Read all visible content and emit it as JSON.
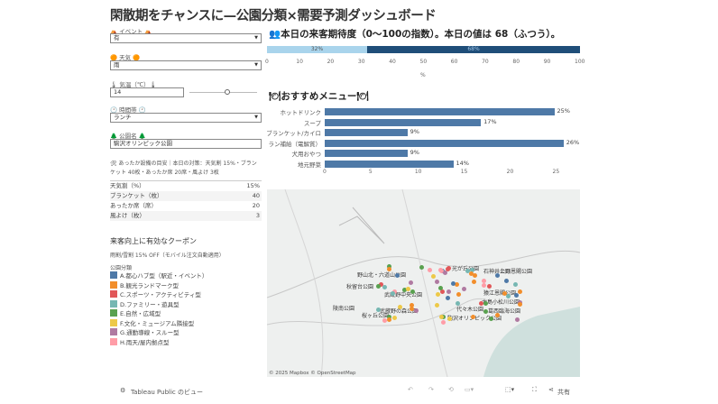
{
  "title": "閑散期をチャンスに—公園分類×需要予測ダッシュボード",
  "filters": {
    "event": {
      "label": "⛺ イベント ⛺",
      "value": "有"
    },
    "weather": {
      "label": "🟠 天気 🟠",
      "value": "雨"
    },
    "temp": {
      "label": "🌡 気温（℃）🌡",
      "value": "14",
      "slider_fraction": 0.6
    },
    "time": {
      "label": "🕐 時間帯 🕐",
      "value": "ランチ"
    },
    "park": {
      "label": "🌲 公園名 🌲",
      "value": "駒沢オリンピック公園"
    }
  },
  "warm": {
    "note": "🛠 あったか設備の目安｜本日の対策：天気割 15%・ブランケット 40枚・あったか席 20席・風よけ 3枚",
    "rows": [
      {
        "k": "天気割（%）",
        "v": "15%"
      },
      {
        "k": "ブランケット（枚）",
        "v": "40"
      },
      {
        "k": "あったか席（席）",
        "v": "20"
      },
      {
        "k": "風よけ（枚）",
        "v": "3"
      }
    ]
  },
  "coupon": {
    "heading": "来客向上に有効なクーポン",
    "text": "雨割/雪割 15% OFF（モバイル注文自動適用）"
  },
  "legend": {
    "title": "公園分類",
    "items": [
      {
        "label": "A.都心ハブ型（駅近・イベント）",
        "color": "#4e79a7"
      },
      {
        "label": "B.観光ランドマーク型",
        "color": "#f28e2b"
      },
      {
        "label": "C.スポーツ・アクティビティ型",
        "color": "#e15759"
      },
      {
        "label": "D.ファミリー・遊具型",
        "color": "#76b7b2"
      },
      {
        "label": "E.自然・広域型",
        "color": "#59a14f"
      },
      {
        "label": "F.文化・ミュージアム隣接型",
        "color": "#edc948"
      },
      {
        "label": "G.通勤導線・スルー型",
        "color": "#b07aa1"
      },
      {
        "label": "H.雨天/屋内拠点型",
        "color": "#ff9da7"
      }
    ]
  },
  "chart_data": [
    {
      "type": "bar",
      "title": "👥本日の来客期待度（0〜100の指数）。本日の値は 68（ふつう）。",
      "xlabel": "%",
      "xlim": [
        0,
        100
      ],
      "ticks": [
        "0",
        "10",
        "20",
        "30",
        "40",
        "50",
        "60",
        "70",
        "80",
        "90",
        "100"
      ],
      "series": [
        {
          "name": "remaining",
          "value": 32,
          "label": "32%",
          "color": "#a9d4ec"
        },
        {
          "name": "expected",
          "value": 68,
          "label": "68%",
          "color": "#1f4e79"
        }
      ]
    },
    {
      "type": "bar",
      "title": "🍽おすすめメニュー🍽",
      "xlim": [
        0,
        27.5
      ],
      "ticks": [
        "0",
        "5",
        "10",
        "15",
        "20",
        "25"
      ],
      "categories": [
        "ホットドリンク",
        "スープ",
        "ブランケット/カイロ",
        "ラン補給（電解質）",
        "犬用おやつ",
        "地元野菜"
      ],
      "values": [
        25,
        17,
        9,
        26,
        9,
        14
      ],
      "labels": [
        "25%",
        "17%",
        "9%",
        "26%",
        "9%",
        "14%"
      ]
    }
  ],
  "map": {
    "attribution": "© 2025 Mapbox  © OpenStreetMap",
    "labels": [
      "野山北・六道山公園",
      "秋留台公園",
      "光が丘公園",
      "石神井公園",
      "武蔵野中央公園",
      "武蔵野の森公園",
      "代々木公園",
      "陵南公園",
      "桜ヶ丘公園",
      "駒沢オリンピック公園",
      "上野恩賜公園",
      "猿江恩賜公園",
      "葛西臨海公園",
      "大島小松川公園"
    ]
  },
  "footer": {
    "brand": "Tableau Public のビュー",
    "share": "共有"
  }
}
